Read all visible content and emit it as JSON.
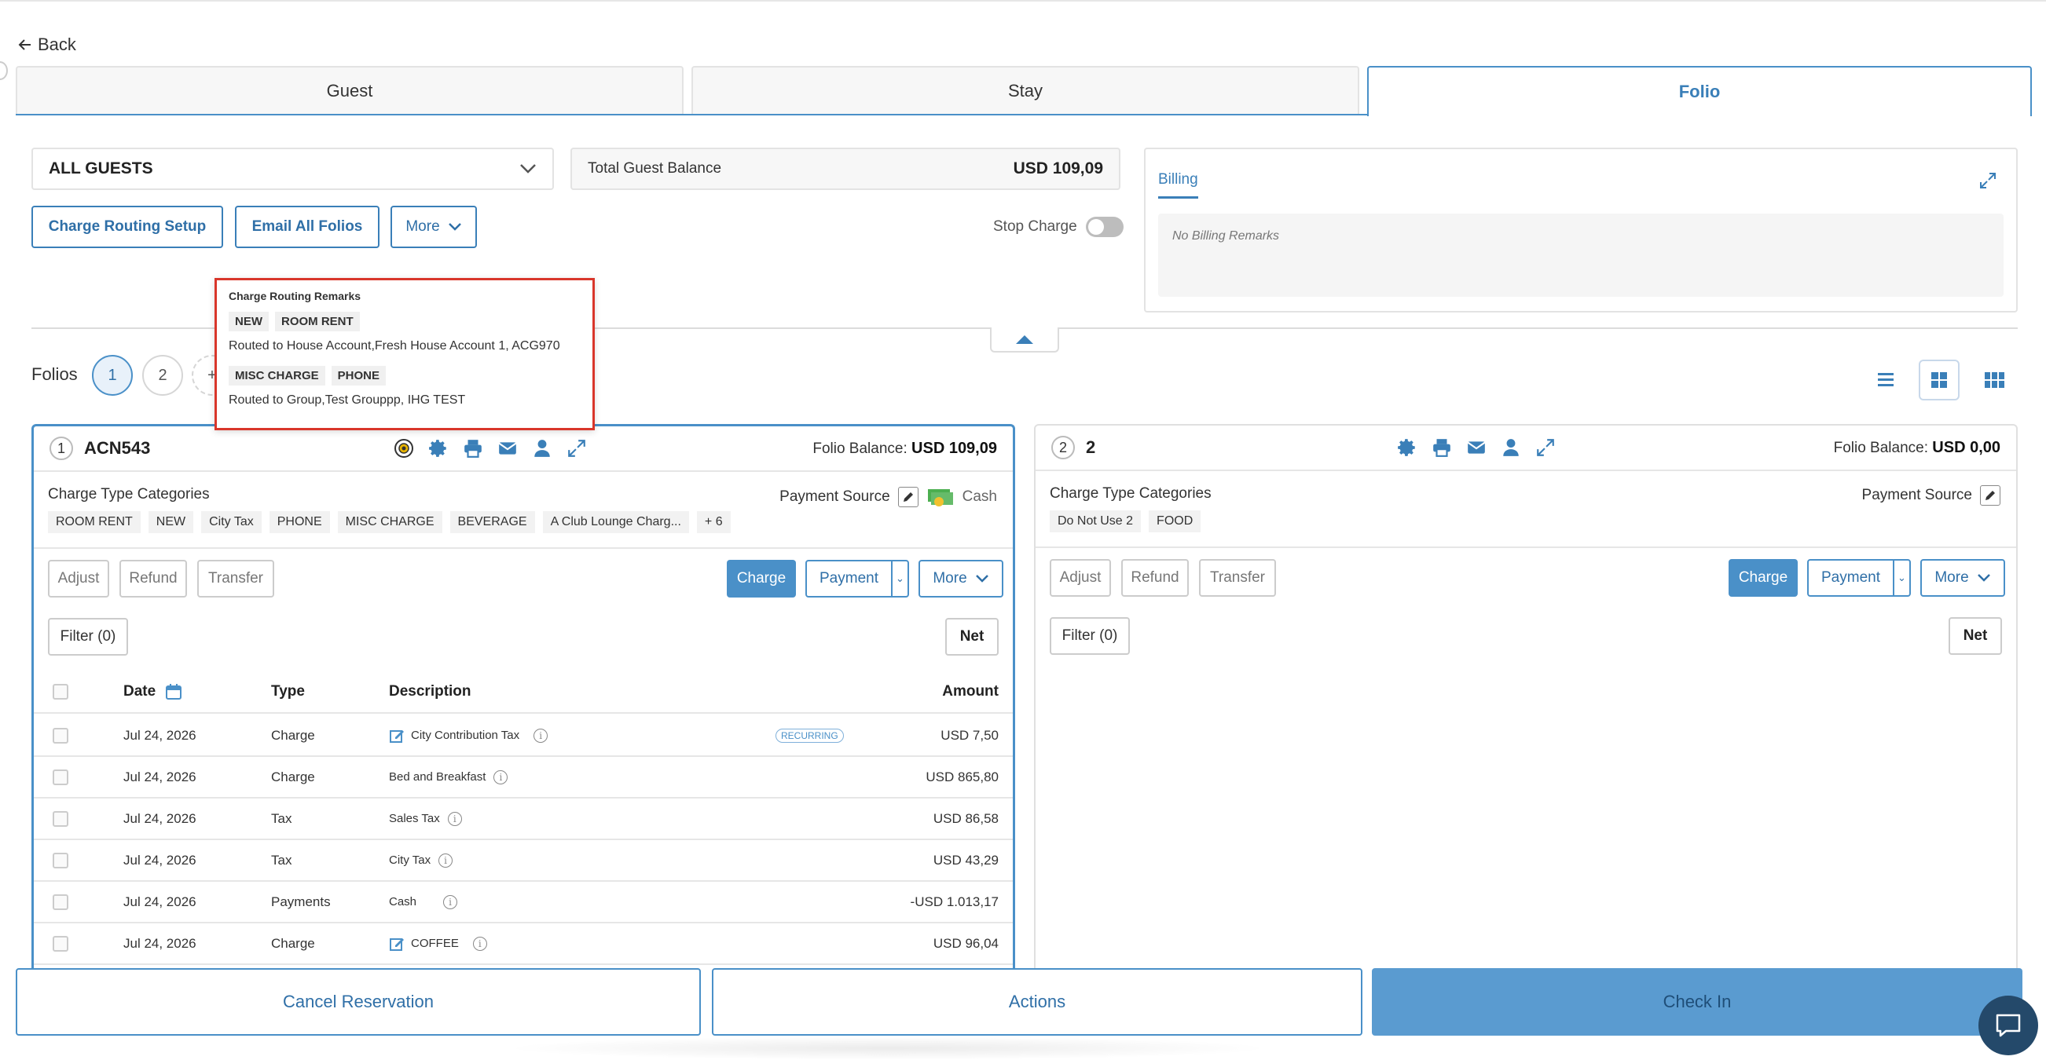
{
  "nav": {
    "back_label": "Back"
  },
  "tabs": [
    {
      "label": "Guest"
    },
    {
      "label": "Stay"
    },
    {
      "label": "Folio",
      "active": true
    }
  ],
  "guest_select": {
    "value": "ALL GUESTS"
  },
  "total_balance": {
    "label": "Total Guest Balance",
    "amount": "USD 109,09"
  },
  "toolbar": {
    "charge_routing_label": "Charge Routing Setup",
    "email_all_label": "Email All Folios",
    "more_label": "More",
    "stop_charge_label": "Stop Charge",
    "stop_charge_on": false
  },
  "billing": {
    "tab_label": "Billing",
    "remarks": "No Billing Remarks"
  },
  "folios_row": {
    "label": "Folios",
    "items": [
      "1",
      "2"
    ],
    "add_symbol": "+"
  },
  "popover": {
    "title": "Charge Routing Remarks",
    "routes": [
      {
        "tags": [
          "NEW",
          "ROOM RENT"
        ],
        "text": "Routed to House Account,Fresh House Account 1, ACG970"
      },
      {
        "tags": [
          "MISC CHARGE",
          "PHONE"
        ],
        "text": "Routed to Group,Test Grouppp, IHG TEST"
      }
    ]
  },
  "folio1": {
    "number": "1",
    "name": "ACN543",
    "balance_label": "Folio Balance:",
    "balance": "USD 109,09",
    "ctc_label": "Charge Type Categories",
    "ctc_tags": [
      "ROOM RENT",
      "NEW",
      "City Tax",
      "PHONE",
      "MISC CHARGE",
      "BEVERAGE",
      "A Club Lounge Charg...",
      "+ 6"
    ],
    "payment_source_label": "Payment Source",
    "payment_source_value": "Cash",
    "buttons": {
      "adjust": "Adjust",
      "refund": "Refund",
      "transfer": "Transfer",
      "charge": "Charge",
      "payment": "Payment",
      "more": "More",
      "filter": "Filter (0)",
      "net": "Net"
    },
    "columns": {
      "date": "Date",
      "type": "Type",
      "description": "Description",
      "amount": "Amount"
    },
    "rows": [
      {
        "date": "Jul 24, 2026",
        "type": "Charge",
        "description": "City Contribution Tax",
        "badge": "RECURRING",
        "amount": "USD 7,50"
      },
      {
        "date": "Jul 24, 2026",
        "type": "Charge",
        "description": "Bed and Breakfast",
        "amount": "USD 865,80"
      },
      {
        "date": "Jul 24, 2026",
        "type": "Tax",
        "description": "Sales Tax",
        "amount": "USD 86,58"
      },
      {
        "date": "Jul 24, 2026",
        "type": "Tax",
        "description": "City Tax",
        "amount": "USD 43,29"
      },
      {
        "date": "Jul 24, 2026",
        "type": "Payments",
        "description": "Cash",
        "amount": "-USD 1.013,17"
      },
      {
        "date": "Jul 24, 2026",
        "type": "Charge",
        "description": "COFFEE",
        "amount": "USD 96,04"
      }
    ]
  },
  "folio2": {
    "number": "2",
    "name": "2",
    "balance_label": "Folio Balance:",
    "balance": "USD 0,00",
    "ctc_label": "Charge Type Categories",
    "ctc_tags": [
      "Do Not Use 2",
      "FOOD"
    ],
    "payment_source_label": "Payment Source",
    "buttons": {
      "adjust": "Adjust",
      "refund": "Refund",
      "transfer": "Transfer",
      "charge": "Charge",
      "payment": "Payment",
      "more": "More",
      "filter": "Filter (0)",
      "net": "Net"
    }
  },
  "bottom": {
    "cancel_label": "Cancel Reservation",
    "actions_label": "Actions",
    "checkin_label": "Check In"
  },
  "colors": {
    "accent": "#4a90c8",
    "highlight_border": "#d9362b",
    "chat_bg": "#24496a"
  }
}
